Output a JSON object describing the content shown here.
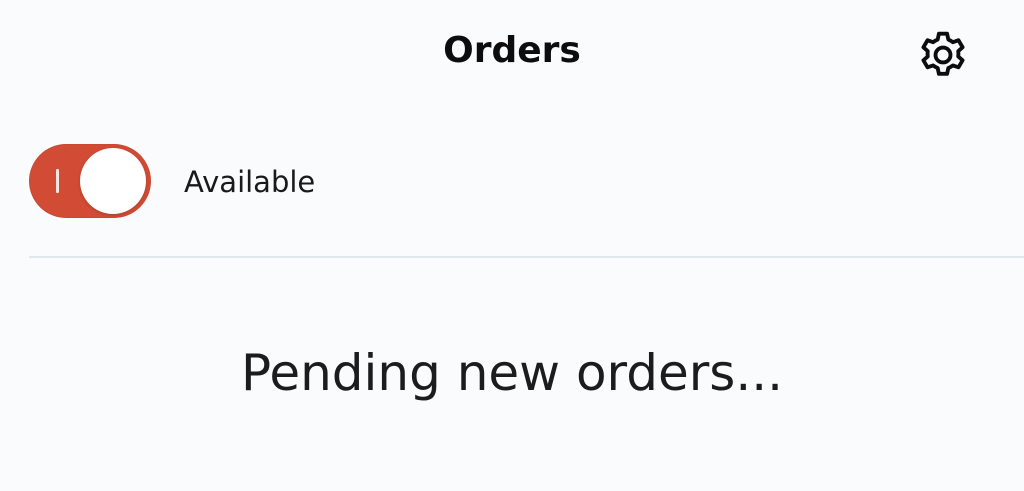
{
  "header": {
    "title": "Orders",
    "settings_icon": "gear-icon"
  },
  "availability": {
    "toggle_state": "on",
    "toggle_on_glyph": "I",
    "toggle_color": "#d24b34",
    "label": "Available"
  },
  "orders": {
    "empty_message": "Pending new orders..."
  }
}
